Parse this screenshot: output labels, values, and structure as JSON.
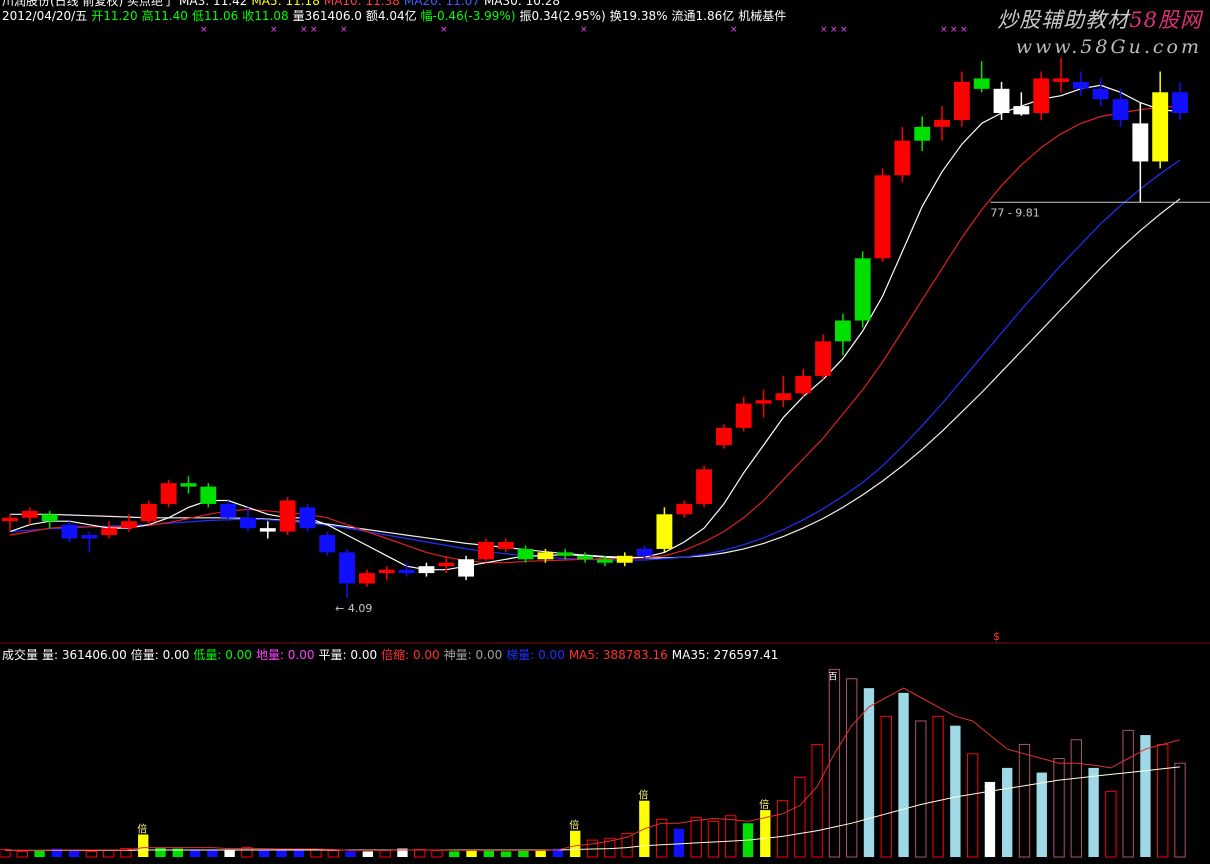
{
  "header": {
    "row1": [
      {
        "text": "川润股份(日线 前复权) 买点绝了",
        "color": "#ffffff"
      },
      {
        "text": "MA3: 11.42",
        "color": "#ffffff"
      },
      {
        "text": "MA5: 11.18",
        "color": "#ffff00"
      },
      {
        "text": "MA10: 11.38",
        "color": "#ff4040"
      },
      {
        "text": "MA20: 11.07",
        "color": "#4060ff"
      },
      {
        "text": "MA30: 10.28",
        "color": "#ffffff"
      }
    ],
    "row2": [
      {
        "text": "2012/04/20/五",
        "color": "#ffffff"
      },
      {
        "text": "开11.20",
        "color": "#00ff00"
      },
      {
        "text": "高11.40",
        "color": "#00ff00"
      },
      {
        "text": "低11.06",
        "color": "#00ff00"
      },
      {
        "text": "收11.08",
        "color": "#00ff00"
      },
      {
        "text": "量361406.0",
        "color": "#ffffff"
      },
      {
        "text": "额4.04亿",
        "color": "#ffffff"
      },
      {
        "text": "幅-0.46(-3.99%)",
        "color": "#00ff00"
      },
      {
        "text": "振0.34(2.95%)",
        "color": "#ffffff"
      },
      {
        "text": "换19.38%",
        "color": "#ffffff"
      },
      {
        "text": "流通1.86亿",
        "color": "#ffffff"
      },
      {
        "text": "机械基件",
        "color": "#ffffff"
      }
    ]
  },
  "watermark": {
    "line1_prefix": "炒股辅助教材",
    "line1_brand": "58股网",
    "line2": "www.58Gu.com"
  },
  "annotations": {
    "high_label": "77 - 9.81",
    "low_label": "← 4.09",
    "vol_marker": "$"
  },
  "volume_header": [
    {
      "text": "成交量",
      "color": "#ffffff"
    },
    {
      "text": "量: 361406.00",
      "color": "#ffffff"
    },
    {
      "text": "倍量: 0.00",
      "color": "#ffffff"
    },
    {
      "text": "低量: 0.00",
      "color": "#00ff00"
    },
    {
      "text": "地量: 0.00",
      "color": "#ff40ff"
    },
    {
      "text": "平量: 0.00",
      "color": "#ffffff"
    },
    {
      "text": "倍缩: 0.00",
      "color": "#ff3030"
    },
    {
      "text": "神量: 0.00",
      "color": "#a0a0a0"
    },
    {
      "text": "梯量: 0.00",
      "color": "#2030ff"
    },
    {
      "text": "MA5: 388783.16",
      "color": "#ff3030"
    },
    {
      "text": "MA35: 276597.41",
      "color": "#ffffff"
    }
  ],
  "vol_labels": {
    "bei": "倍",
    "zhang": "百"
  },
  "colors": {
    "up": "#ff0000",
    "down": "#00e000",
    "blue": "#1010ff",
    "white": "#ffffff",
    "yellow": "#ffff00",
    "ma5": "#ffffff",
    "ma10": "#ffff00",
    "ma20": "#e02020",
    "ma30": "#2030ff"
  },
  "chart_data": {
    "type": "candlestick",
    "price_candles": [
      [
        5.2,
        5.3,
        5.05,
        5.25,
        "r"
      ],
      [
        5.25,
        5.4,
        5.15,
        5.35,
        "r"
      ],
      [
        5.3,
        5.35,
        5.1,
        5.2,
        "g"
      ],
      [
        5.15,
        5.2,
        4.9,
        4.95,
        "b"
      ],
      [
        4.95,
        5.05,
        4.75,
        5.0,
        "b"
      ],
      [
        5.0,
        5.2,
        4.95,
        5.1,
        "r"
      ],
      [
        5.1,
        5.3,
        5.05,
        5.2,
        "r"
      ],
      [
        5.2,
        5.5,
        5.15,
        5.45,
        "r"
      ],
      [
        5.45,
        5.8,
        5.4,
        5.75,
        "r"
      ],
      [
        5.75,
        5.85,
        5.6,
        5.7,
        "g"
      ],
      [
        5.7,
        5.75,
        5.4,
        5.45,
        "g"
      ],
      [
        5.45,
        5.5,
        5.2,
        5.25,
        "b"
      ],
      [
        5.25,
        5.4,
        5.05,
        5.1,
        "b"
      ],
      [
        5.1,
        5.2,
        4.95,
        5.05,
        "w"
      ],
      [
        5.05,
        5.55,
        5.0,
        5.5,
        "r"
      ],
      [
        5.4,
        5.45,
        5.05,
        5.1,
        "b"
      ],
      [
        5.0,
        5.05,
        4.7,
        4.75,
        "b"
      ],
      [
        4.75,
        4.8,
        4.09,
        4.3,
        "b"
      ],
      [
        4.3,
        4.5,
        4.25,
        4.45,
        "r"
      ],
      [
        4.45,
        4.55,
        4.35,
        4.5,
        "r"
      ],
      [
        4.5,
        4.6,
        4.4,
        4.45,
        "b"
      ],
      [
        4.45,
        4.6,
        4.4,
        4.55,
        "w"
      ],
      [
        4.55,
        4.7,
        4.45,
        4.6,
        "r"
      ],
      [
        4.4,
        4.7,
        4.35,
        4.65,
        "w"
      ],
      [
        4.65,
        4.95,
        4.6,
        4.9,
        "r"
      ],
      [
        4.9,
        4.95,
        4.75,
        4.8,
        "r"
      ],
      [
        4.8,
        4.85,
        4.6,
        4.65,
        "g"
      ],
      [
        4.65,
        4.8,
        4.6,
        4.75,
        "y"
      ],
      [
        4.75,
        4.8,
        4.65,
        4.7,
        "g"
      ],
      [
        4.7,
        4.75,
        4.6,
        4.65,
        "g"
      ],
      [
        4.65,
        4.7,
        4.55,
        4.6,
        "g"
      ],
      [
        4.6,
        4.75,
        4.55,
        4.7,
        "y"
      ],
      [
        4.7,
        4.85,
        4.65,
        4.8,
        "b"
      ],
      [
        4.8,
        5.4,
        4.75,
        5.3,
        "y"
      ],
      [
        5.3,
        5.5,
        5.25,
        5.45,
        "r"
      ],
      [
        5.45,
        6.0,
        5.4,
        5.95,
        "r"
      ],
      [
        6.3,
        6.6,
        6.25,
        6.55,
        "r"
      ],
      [
        6.55,
        7.0,
        6.5,
        6.9,
        "r"
      ],
      [
        6.9,
        7.1,
        6.7,
        6.95,
        "r"
      ],
      [
        6.95,
        7.3,
        6.85,
        7.05,
        "r"
      ],
      [
        7.05,
        7.4,
        7.0,
        7.3,
        "r"
      ],
      [
        7.3,
        7.9,
        7.25,
        7.8,
        "r"
      ],
      [
        7.8,
        8.2,
        7.6,
        8.1,
        "g"
      ],
      [
        8.1,
        9.1,
        8.0,
        9.0,
        "g"
      ],
      [
        9.0,
        10.3,
        8.95,
        10.2,
        "r"
      ],
      [
        10.2,
        10.9,
        10.1,
        10.7,
        "r"
      ],
      [
        10.7,
        11.05,
        10.55,
        10.9,
        "g"
      ],
      [
        10.9,
        11.2,
        10.7,
        11.0,
        "r"
      ],
      [
        11.0,
        11.7,
        10.9,
        11.55,
        "r"
      ],
      [
        11.6,
        11.85,
        11.4,
        11.45,
        "g"
      ],
      [
        11.45,
        11.55,
        11.0,
        11.1,
        "w"
      ],
      [
        11.2,
        11.4,
        11.06,
        11.08,
        "w"
      ],
      [
        11.1,
        11.7,
        11.0,
        11.6,
        "r"
      ],
      [
        11.6,
        11.9,
        11.4,
        11.55,
        "r"
      ],
      [
        11.55,
        11.7,
        11.35,
        11.45,
        "b"
      ],
      [
        11.45,
        11.6,
        11.2,
        11.3,
        "b"
      ],
      [
        11.3,
        11.45,
        10.9,
        11.0,
        "b"
      ],
      [
        10.95,
        11.25,
        9.81,
        10.4,
        "w"
      ],
      [
        10.4,
        11.7,
        10.3,
        11.4,
        "y"
      ],
      [
        11.4,
        11.55,
        11.0,
        11.1,
        "b"
      ]
    ],
    "ma5": [
      5.05,
      5.15,
      5.2,
      5.2,
      5.15,
      5.1,
      5.1,
      5.15,
      5.25,
      5.4,
      5.5,
      5.5,
      5.4,
      5.3,
      5.25,
      5.25,
      5.15,
      5.0,
      4.85,
      4.7,
      4.55,
      4.5,
      4.5,
      4.55,
      4.6,
      4.65,
      4.7,
      4.7,
      4.72,
      4.7,
      4.68,
      4.67,
      4.68,
      4.75,
      4.9,
      5.1,
      5.45,
      5.9,
      6.3,
      6.7,
      7.0,
      7.25,
      7.55,
      7.95,
      8.45,
      9.1,
      9.75,
      10.25,
      10.65,
      10.95,
      11.1,
      11.2,
      11.3,
      11.35,
      11.45,
      11.5,
      11.4,
      11.25,
      11.15,
      11.12
    ],
    "ma10": [
      5.0,
      5.05,
      5.1,
      5.12,
      5.12,
      5.12,
      5.12,
      5.14,
      5.18,
      5.24,
      5.3,
      5.35,
      5.37,
      5.35,
      5.32,
      5.3,
      5.25,
      5.15,
      5.05,
      4.95,
      4.85,
      4.75,
      4.68,
      4.63,
      4.6,
      4.6,
      4.62,
      4.63,
      4.64,
      4.65,
      4.66,
      4.66,
      4.67,
      4.7,
      4.78,
      4.9,
      5.05,
      5.25,
      5.5,
      5.8,
      6.1,
      6.4,
      6.75,
      7.1,
      7.5,
      7.95,
      8.4,
      8.85,
      9.3,
      9.7,
      10.05,
      10.35,
      10.6,
      10.8,
      10.95,
      11.05,
      11.1,
      11.15,
      11.18,
      11.2
    ],
    "ma20": [
      5.05,
      5.07,
      5.09,
      5.1,
      5.12,
      5.13,
      5.14,
      5.15,
      5.17,
      5.19,
      5.21,
      5.22,
      5.23,
      5.22,
      5.2,
      5.18,
      5.14,
      5.1,
      5.05,
      5.0,
      4.95,
      4.9,
      4.85,
      4.8,
      4.76,
      4.73,
      4.7,
      4.68,
      4.66,
      4.65,
      4.64,
      4.64,
      4.64,
      4.66,
      4.68,
      4.72,
      4.78,
      4.86,
      4.96,
      5.08,
      5.22,
      5.38,
      5.56,
      5.76,
      6.0,
      6.28,
      6.58,
      6.9,
      7.24,
      7.58,
      7.92,
      8.26,
      8.58,
      8.9,
      9.2,
      9.5,
      9.76,
      10.0,
      10.22,
      10.42
    ],
    "ma30": [
      5.3,
      5.3,
      5.3,
      5.29,
      5.28,
      5.27,
      5.26,
      5.25,
      5.25,
      5.25,
      5.25,
      5.25,
      5.24,
      5.23,
      5.21,
      5.19,
      5.16,
      5.12,
      5.08,
      5.04,
      5.0,
      4.96,
      4.92,
      4.88,
      4.85,
      4.82,
      4.79,
      4.76,
      4.73,
      4.71,
      4.69,
      4.68,
      4.67,
      4.67,
      4.68,
      4.7,
      4.74,
      4.8,
      4.88,
      4.98,
      5.1,
      5.24,
      5.4,
      5.58,
      5.78,
      6.0,
      6.24,
      6.5,
      6.78,
      7.06,
      7.36,
      7.66,
      7.96,
      8.26,
      8.56,
      8.86,
      9.14,
      9.4,
      9.64,
      9.86
    ],
    "y_range": [
      3.7,
      12.3
    ],
    "volumes": [
      [
        8,
        "r"
      ],
      [
        6,
        "r"
      ],
      [
        7,
        "g"
      ],
      [
        9,
        "b"
      ],
      [
        7,
        "b"
      ],
      [
        6,
        "r"
      ],
      [
        7,
        "r"
      ],
      [
        9,
        "r"
      ],
      [
        24,
        "y"
      ],
      [
        10,
        "g"
      ],
      [
        9,
        "g"
      ],
      [
        8,
        "b"
      ],
      [
        8,
        "b"
      ],
      [
        7,
        "w"
      ],
      [
        10,
        "r"
      ],
      [
        8,
        "b"
      ],
      [
        7,
        "b"
      ],
      [
        9,
        "b"
      ],
      [
        8,
        "r"
      ],
      [
        7,
        "r"
      ],
      [
        6,
        "b"
      ],
      [
        6,
        "w"
      ],
      [
        7,
        "r"
      ],
      [
        9,
        "w"
      ],
      [
        8,
        "r"
      ],
      [
        7,
        "r"
      ],
      [
        6,
        "g"
      ],
      [
        8,
        "y"
      ],
      [
        7,
        "g"
      ],
      [
        6,
        "g"
      ],
      [
        7,
        "g"
      ],
      [
        8,
        "y"
      ],
      [
        9,
        "b"
      ],
      [
        28,
        "y"
      ],
      [
        18,
        "r"
      ],
      [
        20,
        "r"
      ],
      [
        25,
        "r"
      ],
      [
        60,
        "y"
      ],
      [
        40,
        "r"
      ],
      [
        30,
        "b"
      ],
      [
        42,
        "r"
      ],
      [
        38,
        "r"
      ],
      [
        44,
        "r"
      ],
      [
        36,
        "g"
      ],
      [
        50,
        "y"
      ],
      [
        60,
        "r"
      ],
      [
        85,
        "r"
      ],
      [
        120,
        "r"
      ],
      [
        200,
        "mr"
      ],
      [
        190,
        "mr"
      ],
      [
        180,
        "c"
      ],
      [
        150,
        "r"
      ],
      [
        175,
        "c"
      ],
      [
        145,
        "mr"
      ],
      [
        150,
        "r"
      ],
      [
        140,
        "c"
      ],
      [
        110,
        "r"
      ],
      [
        80,
        "w"
      ],
      [
        95,
        "c"
      ],
      [
        120,
        "mr"
      ],
      [
        90,
        "c"
      ],
      [
        105,
        "mr"
      ],
      [
        125,
        "mr"
      ],
      [
        95,
        "c"
      ],
      [
        70,
        "r"
      ],
      [
        135,
        "mr"
      ],
      [
        130,
        "c"
      ],
      [
        120,
        "r"
      ],
      [
        100,
        "mr"
      ]
    ],
    "vol_ma5": [
      7,
      7,
      7,
      7.5,
      7.5,
      7.5,
      7.5,
      7.5,
      10,
      10,
      10,
      10,
      10,
      9,
      9,
      9,
      8.5,
      8.5,
      8.5,
      8,
      7,
      7,
      7,
      7.5,
      7.5,
      7.5,
      7,
      7,
      7,
      7,
      7,
      7,
      7.5,
      12,
      14,
      17,
      21,
      30,
      36,
      36,
      39,
      41,
      40,
      38,
      42,
      46,
      55,
      75,
      110,
      140,
      160,
      170,
      180,
      170,
      160,
      150,
      145,
      130,
      115,
      110,
      105,
      100,
      100,
      98,
      95,
      105,
      115,
      120,
      125
    ],
    "vol_ma35": [
      7,
      7,
      7,
      7,
      7,
      7,
      7,
      7,
      7.5,
      7.5,
      7.5,
      7.5,
      7.5,
      7.5,
      7.5,
      7.5,
      7.5,
      7.5,
      7.5,
      7.5,
      7.5,
      7.5,
      7.5,
      7.5,
      7.5,
      7.5,
      7.5,
      7.5,
      7.5,
      7.5,
      7.5,
      7.5,
      7.5,
      8,
      8.5,
      9,
      10,
      12,
      13,
      14,
      15,
      16,
      17,
      18,
      20,
      22,
      25,
      28,
      32,
      36,
      41,
      46,
      51,
      56,
      60,
      64,
      67,
      70,
      73,
      76,
      79,
      82,
      84,
      86,
      88,
      90,
      92,
      94,
      96
    ],
    "vol_max": 210
  }
}
